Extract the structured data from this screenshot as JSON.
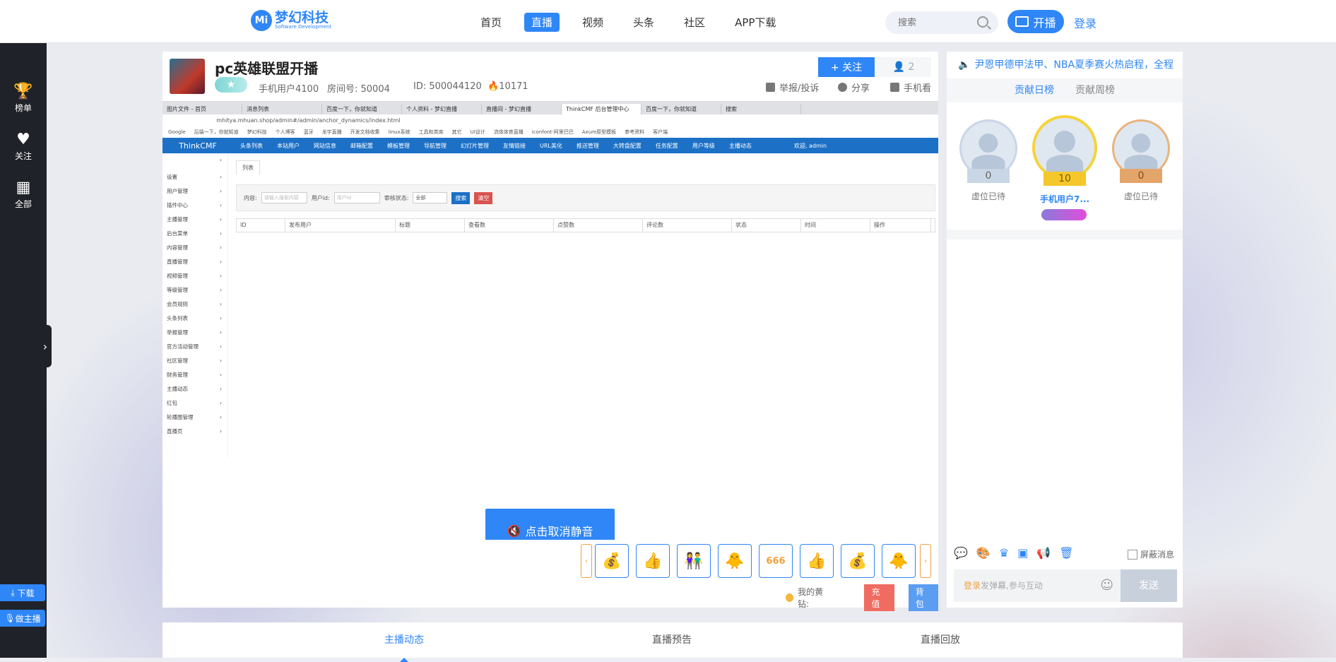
{
  "brand": {
    "mark": "Mi",
    "name": "梦幻科技",
    "tagline": "Software Development"
  },
  "nav": {
    "items": [
      "首页",
      "直播",
      "视频",
      "头条",
      "社区",
      "APP下载"
    ],
    "active": "直播"
  },
  "search": {
    "placeholder": "搜索"
  },
  "header": {
    "live_label": "开播",
    "login_label": "登录"
  },
  "sidebar": {
    "items": [
      {
        "label": "榜单",
        "icon": "trophy-icon"
      },
      {
        "label": "关注",
        "icon": "heart-icon"
      },
      {
        "label": "全部",
        "icon": "grid-icon"
      }
    ],
    "download_label": "下载",
    "anchor_label": "做主播"
  },
  "room": {
    "title": "pc英雄联盟开播",
    "anchor": "手机用户4100",
    "room_no": "房间号: 50004",
    "id": "ID: 500044120",
    "heat": "10171",
    "follow_label": "+ 关注",
    "follow_count": "2",
    "report_label": "举报/投诉",
    "share_label": "分享",
    "mobile_label": "手机看"
  },
  "screen": {
    "tabs": [
      "图片文件 - 首页",
      "消息列表",
      "百度一下，你就知道",
      "个人资料 - 梦幻直播",
      "直播间 - 梦幻直播",
      "ThinkCMF 后台管理中心",
      "百度一下，你就知道",
      "搜索"
    ],
    "url": "mhitya.mhuan.shop/admin#/admin/anchor_dynamics/index.html",
    "bookmarks": [
      "Google",
      "后端一下，你就知道",
      "梦幻科技",
      "个人博客",
      "蓝牙",
      "龙宇直播",
      "开发文档收集",
      "linux系统",
      "工具和类库",
      "其它",
      "UI设计",
      "流体体育直播",
      "iconfont-阿里巴巴",
      "Axure原型模板",
      "参考资料",
      "客户端"
    ],
    "cmf_brand": "ThinkCMF",
    "cmf_menu": [
      "头条列表",
      "本站用户",
      "网站信息",
      "邮箱配置",
      "模板管理",
      "导航管理",
      "幻灯片管理",
      "友情链接",
      "URL美化",
      "推送管理",
      "大转盘配置",
      "任务配置",
      "用户等级",
      "主播动态"
    ],
    "admin_label": "欢迎, admin",
    "cmf_side": [
      "设置",
      "用户管理",
      "插件中心",
      "主播管理",
      "后台菜单",
      "内容管理",
      "直播管理",
      "视频管理",
      "等级管理",
      "会员规则",
      "头条列表",
      "举报管理",
      "官方活动管理",
      "社区管理",
      "财务管理",
      "主播动态",
      "红包",
      "轮播图管理",
      "直播页"
    ],
    "list_tab": "列表",
    "filter_content": "内容:",
    "filter_content_ph": "请输入搜索内容",
    "filter_uid": "用户id:",
    "filter_uid_ph": "用户id",
    "filter_status": "审核状态:",
    "filter_status_val": "全部",
    "search_btn": "搜索",
    "clear_btn": "清空",
    "columns": [
      "ID",
      "发布用户",
      "标题",
      "查看数",
      "点赞数",
      "评论数",
      "状态",
      "时间",
      "操作"
    ]
  },
  "unmute_label": "点击取消静音",
  "gifts": [
    "💰",
    "👍",
    "👫",
    "🐥",
    "666",
    "👍",
    "💰",
    "🐥"
  ],
  "wallet": {
    "label": "我的黄钻:",
    "recharge": "充值",
    "backpack": "背包"
  },
  "right": {
    "notice": "尹恩甲德甲法甲、NBA夏季赛火热启程，全程",
    "rank_tabs": [
      "贡献日榜",
      "贡献周榜"
    ],
    "podium": [
      {
        "name": "虚位已待",
        "score": "0"
      },
      {
        "name": "手机用户7...",
        "score": "10"
      },
      {
        "name": "虚位已待",
        "score": "0"
      }
    ],
    "block_label": "屏蔽消息",
    "login_label": "登录",
    "chat_placeholder": "发弹幕,参与互动",
    "send_label": "发送"
  },
  "bottom_tabs": [
    "主播动态",
    "直播预告",
    "直播回放"
  ]
}
